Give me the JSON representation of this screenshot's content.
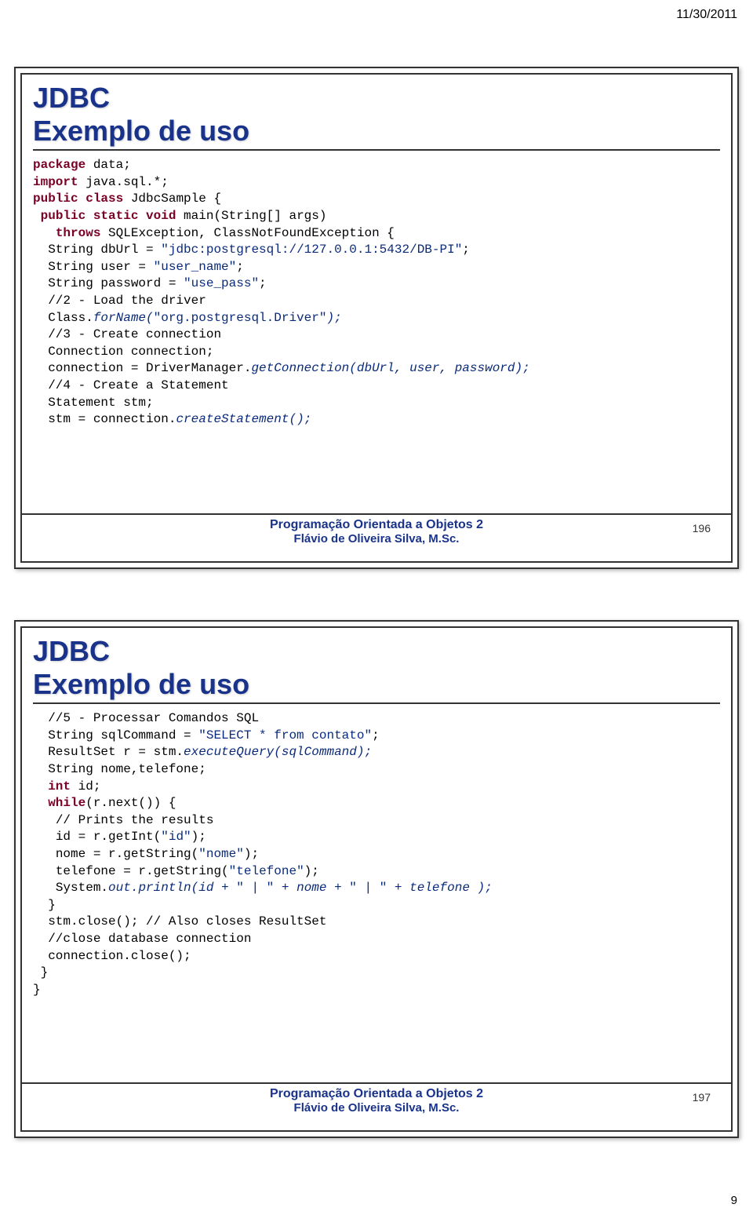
{
  "meta": {
    "date": "11/30/2011",
    "page_number": "9"
  },
  "footer": {
    "line1": "Programação Orientada a Objetos 2",
    "line2": "Flávio de Oliveira Silva, M.Sc."
  },
  "slides": [
    {
      "slide_number": "196",
      "title_line1": "JDBC",
      "title_line2": "Exemplo de uso",
      "code": {
        "l01a": "package",
        "l01b": " data;",
        "l02a": "import",
        "l02b": " java.sql.*;",
        "l03a": "public class ",
        "l03b": "JdbcSample",
        "l03c": " {",
        "l04a": " public static void ",
        "l04b": "main(String[] args)",
        "l05a": "   throws ",
        "l05b": "SQLException, ClassNotFoundException {",
        "l06a": "  String dbUrl = ",
        "l06b": "\"jdbc:postgresql://127.0.0.1:5432/DB-PI\"",
        "l06c": ";",
        "l07a": "  String user = ",
        "l07b": "\"user_name\"",
        "l07c": ";",
        "l08a": "  String password = ",
        "l08b": "\"use_pass\"",
        "l08c": ";",
        "l09": "  //2 - Load the driver",
        "l10a": "  Class.",
        "l10b": "forName(",
        "l10c": "\"org.postgresql.Driver\"",
        "l10d": ");",
        "l11": "  //3 - Create connection",
        "l12": "  Connection connection;",
        "l13a": "  connection = DriverManager.",
        "l13b": "getConnection(dbUrl, user, password);",
        "l14": "  //4 - Create a Statement",
        "l15": "  Statement stm;",
        "l16a": "  stm = connection.",
        "l16b": "createStatement();"
      }
    },
    {
      "slide_number": "197",
      "title_line1": "JDBC",
      "title_line2": "Exemplo de uso",
      "code": {
        "l01": "  //5 - Processar Comandos SQL",
        "l02a": "  String sqlCommand = ",
        "l02b": "\"SELECT * from contato\"",
        "l02c": ";",
        "l03a": "  ResultSet r = stm.",
        "l03b": "executeQuery(sqlCommand);",
        "l04": "  String nome,telefone;",
        "l05a": "  int",
        "l05b": " id;",
        "l06a": "  while",
        "l06b": "(r.next()) {",
        "l07": "   // Prints the results",
        "l08a": "   id = r.getInt(",
        "l08b": "\"id\"",
        "l08c": ");",
        "l09a": "   nome = r.getString(",
        "l09b": "\"nome\"",
        "l09c": ");",
        "l10a": "   telefone = r.getString(",
        "l10b": "\"telefone\"",
        "l10c": ");",
        "l11a": "   System.",
        "l11b": "out",
        "l11c": ".println(id + ",
        "l11d": "\" | \"",
        "l11e": " + nome + ",
        "l11f": "\" | \"",
        "l11g": " + telefone );",
        "l12": "  }",
        "l13": "  stm.close(); // Also closes ResultSet",
        "l14": "  //close database connection",
        "l15": "  connection.close();",
        "l16": " }",
        "l17": "}"
      }
    }
  ]
}
